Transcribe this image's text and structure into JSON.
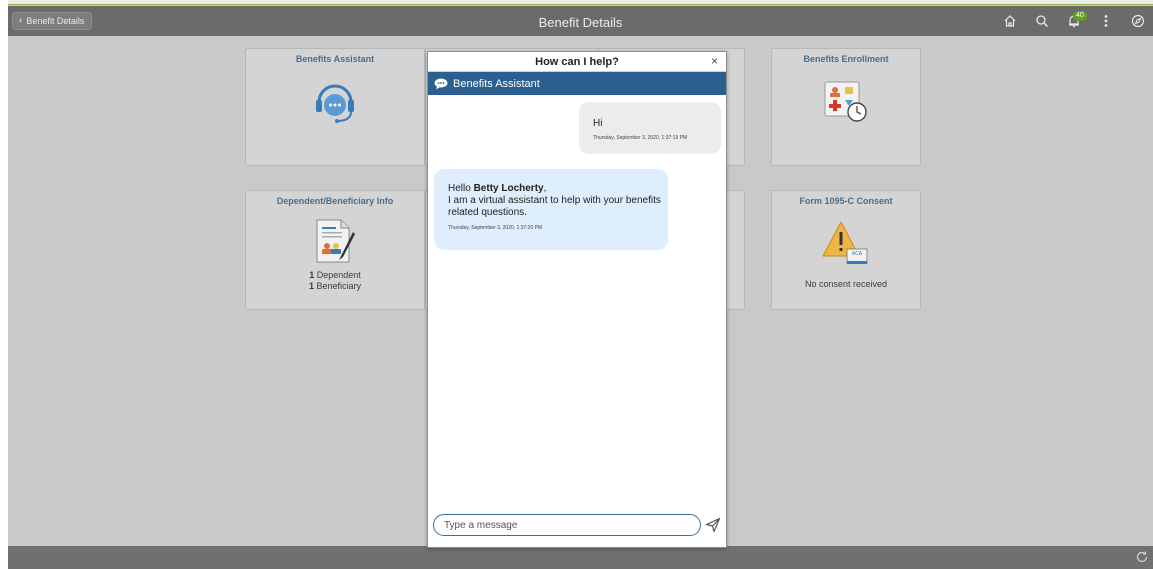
{
  "header": {
    "back_label": "Benefit Details",
    "title": "Benefit Details",
    "notification_count": "40"
  },
  "tiles": {
    "benefits_assistant": {
      "title": "Benefits Assistant"
    },
    "benefits_enrollment": {
      "title": "Benefits Enrollment"
    },
    "dependent_info": {
      "title": "Dependent/Beneficiary Info",
      "dependent_count": "1",
      "dependent_label": "Dependent",
      "beneficiary_count": "1",
      "beneficiary_label": "Beneficiary"
    },
    "form_1095c": {
      "title": "Form 1095-C Consent",
      "status": "No consent received",
      "aca_label": "ACA"
    }
  },
  "dialog": {
    "title": "How can I help?",
    "close_label": "×",
    "bot_name": "Benefits Assistant",
    "messages": [
      {
        "from": "user",
        "text": "Hi",
        "time": "Thursday, September 3, 2020, 1:37:19 PM"
      },
      {
        "from": "bot",
        "greeting": "Hello ",
        "user_name": "Betty Locherty",
        "greeting_end": ",",
        "line2": "I am a virtual assistant to help with your benefits",
        "line3": "related questions.",
        "time": "Thursday, September 3, 2020, 1:37:20 PM"
      }
    ],
    "input_placeholder": "Type a message"
  },
  "colors": {
    "header_bg": "#6b6b6b",
    "bot_bar": "#2a5f8f",
    "bot_bubble": "#deeefd",
    "user_bubble": "#ececec",
    "tile_title": "#4b6d8d",
    "badge": "#5fa31b"
  }
}
